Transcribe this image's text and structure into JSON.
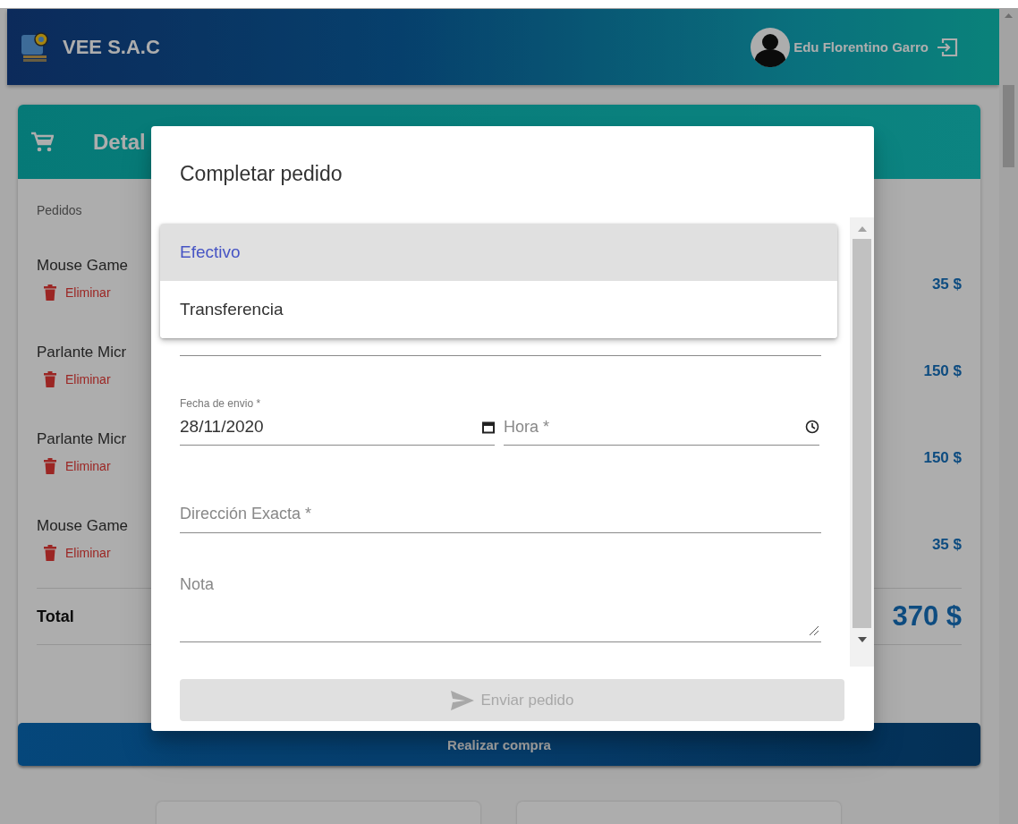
{
  "header": {
    "brand": "VEE S.A.C",
    "user": "Edu Florentino Garro"
  },
  "cart": {
    "title": "Detal",
    "section_label": "Pedidos",
    "items": [
      {
        "name": "Mouse Game",
        "action": "Eliminar",
        "price": "35 $"
      },
      {
        "name": "Parlante Micr",
        "action": "Eliminar",
        "price": "150 $"
      },
      {
        "name": "Parlante Micr",
        "action": "Eliminar",
        "price": "150 $"
      },
      {
        "name": "Mouse Game",
        "action": "Eliminar",
        "price": "35 $"
      }
    ],
    "total_label": "Total",
    "total": "370 $",
    "purchase_button": "Realizar compra"
  },
  "dialog": {
    "title": "Completar pedido",
    "payment_options": [
      {
        "label": "Efectivo",
        "selected": true
      },
      {
        "label": "Transferencia",
        "selected": false
      }
    ],
    "date": {
      "label": "Fecha de envio *",
      "value": "28/11/2020"
    },
    "time": {
      "placeholder": "Hora *"
    },
    "address": {
      "placeholder": "Dirección Exacta *"
    },
    "note": {
      "placeholder": "Nota"
    },
    "submit": {
      "label": "Enviar pedido",
      "disabled": true
    }
  }
}
